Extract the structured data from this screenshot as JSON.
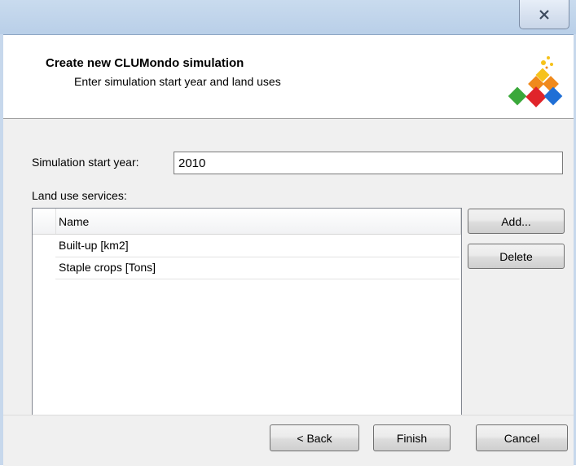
{
  "window": {
    "close_symbol": "close-icon"
  },
  "header": {
    "title": "Create new CLUMondo simulation",
    "subtitle": "Enter simulation start year and land uses"
  },
  "form": {
    "start_year_label": "Simulation start year:",
    "start_year_value": "2010",
    "land_use_label": "Land use services:"
  },
  "list": {
    "column_header": "Name",
    "rows": [
      "Built-up [km2]",
      "Staple crops [Tons]"
    ]
  },
  "buttons": {
    "add": "Add...",
    "delete": "Delete",
    "back": "< Back",
    "finish": "Finish",
    "cancel": "Cancel"
  },
  "colors": {
    "logo_orange": "#f08a1c",
    "logo_red": "#e0242a",
    "logo_green": "#3aa83a",
    "logo_blue": "#1f6fd6",
    "logo_yellow": "#f6c21a"
  }
}
